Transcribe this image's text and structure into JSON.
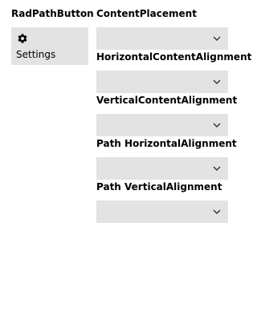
{
  "demo": {
    "title": "RadPathButton"
  },
  "path_button": {
    "icon": "gear-icon",
    "label": "Settings"
  },
  "settings": [
    {
      "label": "ContentPlacement",
      "value": ""
    },
    {
      "label": "HorizontalContentAlignment",
      "value": ""
    },
    {
      "label": "VerticalContentAlignment",
      "value": ""
    },
    {
      "label": "Path HorizontalAlignment",
      "value": ""
    },
    {
      "label": "Path VerticalAlignment",
      "value": ""
    }
  ],
  "colors": {
    "control_background": "#e3e3e3",
    "text": "#000000",
    "chevron": "#333333"
  }
}
